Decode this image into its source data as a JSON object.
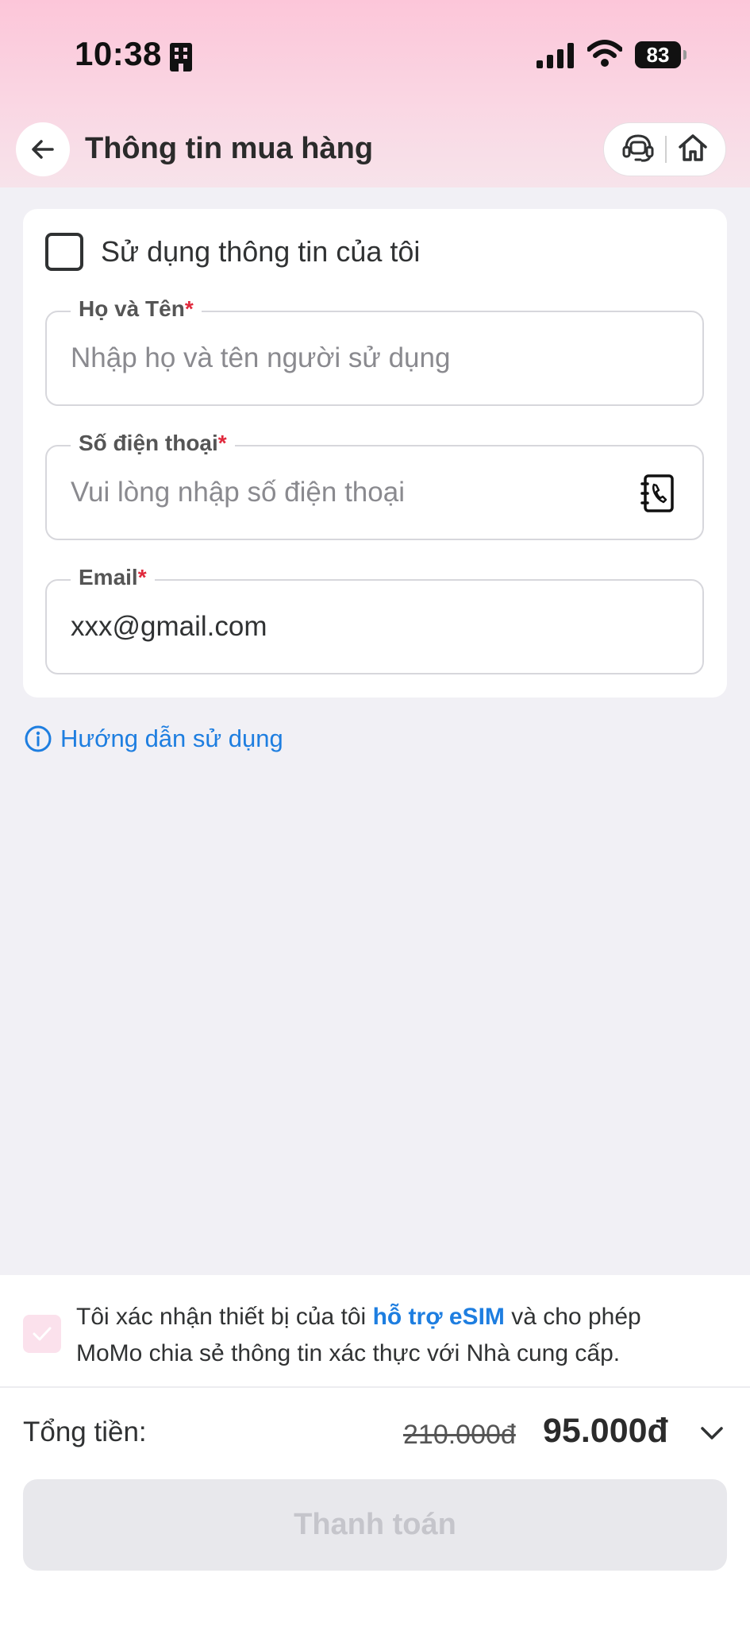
{
  "status_bar": {
    "time": "10:38",
    "battery": "83"
  },
  "header": {
    "title": "Thông tin mua hàng"
  },
  "form": {
    "use_my_info_label": "Sử dụng thông tin của tôi",
    "name": {
      "label": "Họ và Tên",
      "required_mark": "*",
      "placeholder": "Nhập họ và tên người sử dụng"
    },
    "phone": {
      "label": "Số điện thoại",
      "required_mark": "*",
      "placeholder": "Vui lòng nhập số điện thoại"
    },
    "email": {
      "label": "Email",
      "required_mark": "*",
      "value": "xxx@gmail.com"
    }
  },
  "guide_link": "Hướng dẫn sử dụng",
  "confirm": {
    "text_before": "Tôi xác nhận thiết bị của tôi ",
    "link": "hỗ trợ eSIM",
    "text_after": " và cho phép MoMo chia sẻ thông tin xác thực với Nhà cung cấp."
  },
  "total": {
    "label": "Tổng tiền:",
    "old_price": "210.000đ",
    "new_price": "95.000đ"
  },
  "pay_button": "Thanh toán",
  "colors": {
    "accent": "#1e7ee0",
    "required": "#e0293c",
    "header_pink": "#fcc6d9"
  }
}
